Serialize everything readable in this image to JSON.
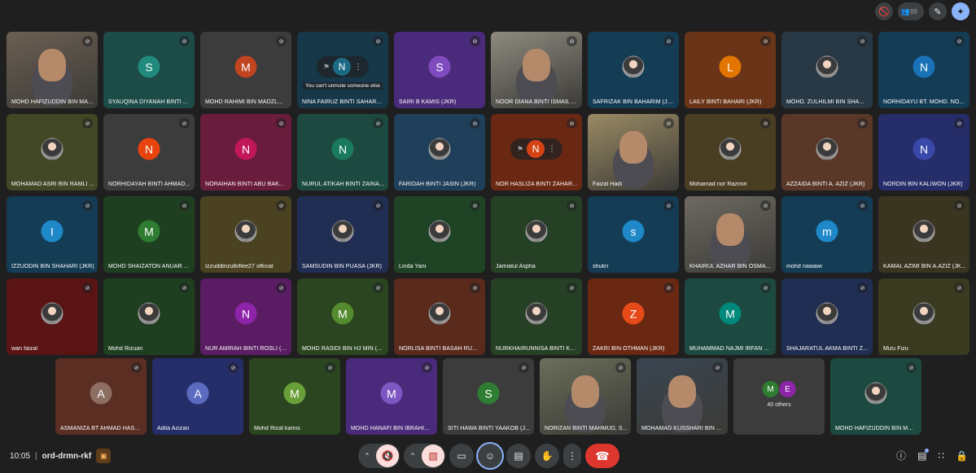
{
  "topbar": {
    "participant_count": "89",
    "icons": [
      "camera-off-icon",
      "people-icon",
      "brush-icon",
      "gemini-spark-icon"
    ]
  },
  "tiles": [
    {
      "name": "MOHD HAFIZUDDIN BIN MA...",
      "type": "video",
      "bg": "#6b5f53"
    },
    {
      "name": "SYAUQINA DIYANAH BINTI ...",
      "initial": "S",
      "bg": "#1d4b47",
      "avatar": "#208a7c"
    },
    {
      "name": "MOHD RAHIMI BIN MADZL...",
      "initial": "M",
      "bg": "#3c3c3c",
      "avatar": "#c0441f",
      "dots": true
    },
    {
      "name": "NINA FAIRUZ BINTI SAHARU...",
      "initial": "N",
      "bg": "#173848",
      "avatar": "#1d6a85",
      "hover": true,
      "tooltip": "You can't unmute someone else"
    },
    {
      "name": "SAIRI B KAMIS (JKR)",
      "initial": "S",
      "bg": "#4a2a7a",
      "avatar": "#7f4bbf"
    },
    {
      "name": "NOOR DIANA BINTI ISMAIL ...",
      "type": "video",
      "bg": "#8e8a80"
    },
    {
      "name": "SAFRIZAK BIN BAHARIM (JKR...",
      "type": "photo",
      "bg": "#143c55"
    },
    {
      "name": "LAILY BINTI BAHARI (JKR)",
      "initial": "L",
      "bg": "#6a3418",
      "avatar": "#e37400"
    },
    {
      "name": "MOHD. ZULHILMI BIN SHA...",
      "type": "photo",
      "bg": "#283845"
    },
    {
      "name": "NORHIDAYU BT. MOHD. NO...",
      "initial": "N",
      "bg": "#143c55",
      "avatar": "#1a73b8"
    },
    {
      "name": "MOHAMAD ASRI BIN RAMLI ...",
      "type": "photo",
      "bg": "#424825"
    },
    {
      "name": "NORHIDAYAH BINTI AHMAD...",
      "initial": "N",
      "bg": "#3c3c3c",
      "avatar": "#e8430f"
    },
    {
      "name": "NORAIHAN BINTI ABU BAK...",
      "initial": "N",
      "bg": "#6a1c3c",
      "avatar": "#c2185b"
    },
    {
      "name": "NURUL ATIKAH BINTI ZAINA...",
      "initial": "N",
      "bg": "#1d4a40",
      "avatar": "#1a7a5e"
    },
    {
      "name": "FARIDAH BINTI JASIN (JKR)",
      "type": "photo",
      "bg": "#1f3f5a"
    },
    {
      "name": "NOR HASLIZA BINTI ZAHARI...",
      "initial": "N",
      "bg": "#6a2812",
      "avatar": "#d84315",
      "hover": true
    },
    {
      "name": "Faizal Hadi",
      "type": "video",
      "bg": "#9a8a64"
    },
    {
      "name": "Mohamad nor Razmin",
      "type": "photo",
      "bg": "#4a3e22"
    },
    {
      "name": "AZZAIDA BINTI A. AZIZ (JKR)",
      "type": "photo",
      "bg": "#5a3828"
    },
    {
      "name": "NORDIN BIN KALIWON (JKR)",
      "initial": "N",
      "bg": "#262e6a",
      "avatar": "#3949ab"
    },
    {
      "name": "IZZUDDIN BIN SHAHARI (JKR)",
      "initial": "I",
      "bg": "#143c55",
      "avatar": "#1e88c8"
    },
    {
      "name": "MOHD SHAIZATON ANUAR ...",
      "initial": "M",
      "bg": "#1f4020",
      "avatar": "#2e7d32"
    },
    {
      "name": "Izzuddinzulkiflee27 official",
      "type": "photo",
      "bg": "#4a4220"
    },
    {
      "name": "SAMSUDIN BIN PUASA (JKR)",
      "type": "photo",
      "bg": "#1f2e52"
    },
    {
      "name": "Linda Yani",
      "type": "photo",
      "bg": "#1f4425"
    },
    {
      "name": "Jamiatul Aspha",
      "type": "photo",
      "bg": "#264025"
    },
    {
      "name": "shukri",
      "initial": "s",
      "bg": "#143c55",
      "avatar": "#1e88c8"
    },
    {
      "name": "KHAIRUL AZHAR BIN OSMA...",
      "type": "video",
      "bg": "#6e6a62"
    },
    {
      "name": "mohd nawawi",
      "initial": "m",
      "bg": "#143c55",
      "avatar": "#1e88c8"
    },
    {
      "name": "KAMAL AZIMI BIN A.AZIZ (JK...",
      "type": "photo",
      "bg": "#3a3520"
    },
    {
      "name": "wan faizal",
      "type": "photo",
      "bg": "#5a1414"
    },
    {
      "name": "Mohd Rizuan",
      "type": "photo",
      "bg": "#1f4020"
    },
    {
      "name": "NUR AMIRAH BINTI ROSLI (J...",
      "initial": "N",
      "bg": "#5a1c62",
      "avatar": "#8e24aa"
    },
    {
      "name": "MOHD RASIDI BIN HJ MIN (...",
      "initial": "M",
      "bg": "#2a4520",
      "avatar": "#558b2f"
    },
    {
      "name": "NORLISA BINTI BASAH RUDI...",
      "type": "photo",
      "bg": "#5a2a1c"
    },
    {
      "name": "NURKHAIRUNNISA BINTI KA...",
      "type": "photo",
      "bg": "#264025"
    },
    {
      "name": "ZAKRI BIN OTHMAN (JKR)",
      "initial": "Z",
      "bg": "#6a2812",
      "avatar": "#e64a19"
    },
    {
      "name": "MUHAMMAD NAJMI IRFAN ...",
      "initial": "M",
      "bg": "#1d4a40",
      "avatar": "#00897b"
    },
    {
      "name": "SHAJARATUL AKMA BINTI Z...",
      "type": "photo",
      "bg": "#1f2e52"
    },
    {
      "name": "Mizu Fizu",
      "type": "photo",
      "bg": "#3a3a20"
    }
  ],
  "last_row": [
    {
      "name": "ASMANIZA BT AHMAD HAS...",
      "initial": "A",
      "bg": "#5a2e22",
      "avatar": "#8d6e63"
    },
    {
      "name": "Adila Azizan",
      "initial": "A",
      "bg": "#262e6a",
      "avatar": "#5c6bc0"
    },
    {
      "name": "Mohd Rizal kamis",
      "initial": "M",
      "bg": "#2a4520",
      "avatar": "#689f38"
    },
    {
      "name": "MOHD HANAFI BIN IBRAHI...",
      "initial": "M",
      "bg": "#4a2a7a",
      "avatar": "#7e57c2"
    },
    {
      "name": "SITI HAWA BINTI YAAKOB (J...",
      "initial": "S",
      "bg": "#3c3c3c",
      "avatar": "#2e7d32"
    },
    {
      "name": "NORIZAN BINTI MAHMUD, S...",
      "type": "video",
      "bg": "#6a6e5a"
    },
    {
      "name": "MOHAMAD KUSSHARI BIN ...",
      "type": "video",
      "bg": "#3a4652"
    },
    {
      "others": true,
      "label": "40 others",
      "initials": [
        "M",
        "E"
      ],
      "colors": [
        "#2e7d32",
        "#8e24aa"
      ],
      "bg": "#3c3c3c"
    },
    {
      "name": "MOHD HAFIZUDDIN BIN M...",
      "type": "photo",
      "bg": "#1d4a40"
    }
  ],
  "bottombar": {
    "time": "10:05",
    "separator": "|",
    "meeting_code": "ord-drmn-rkf",
    "controls": [
      "mic-off-icon",
      "camera-off-icon",
      "present-icon",
      "emoji-icon",
      "captions-icon",
      "raise-hand-icon",
      "more-icon",
      "end-call-icon"
    ],
    "right": [
      "info-icon",
      "chat-icon",
      "activities-icon",
      "lock-icon"
    ]
  }
}
